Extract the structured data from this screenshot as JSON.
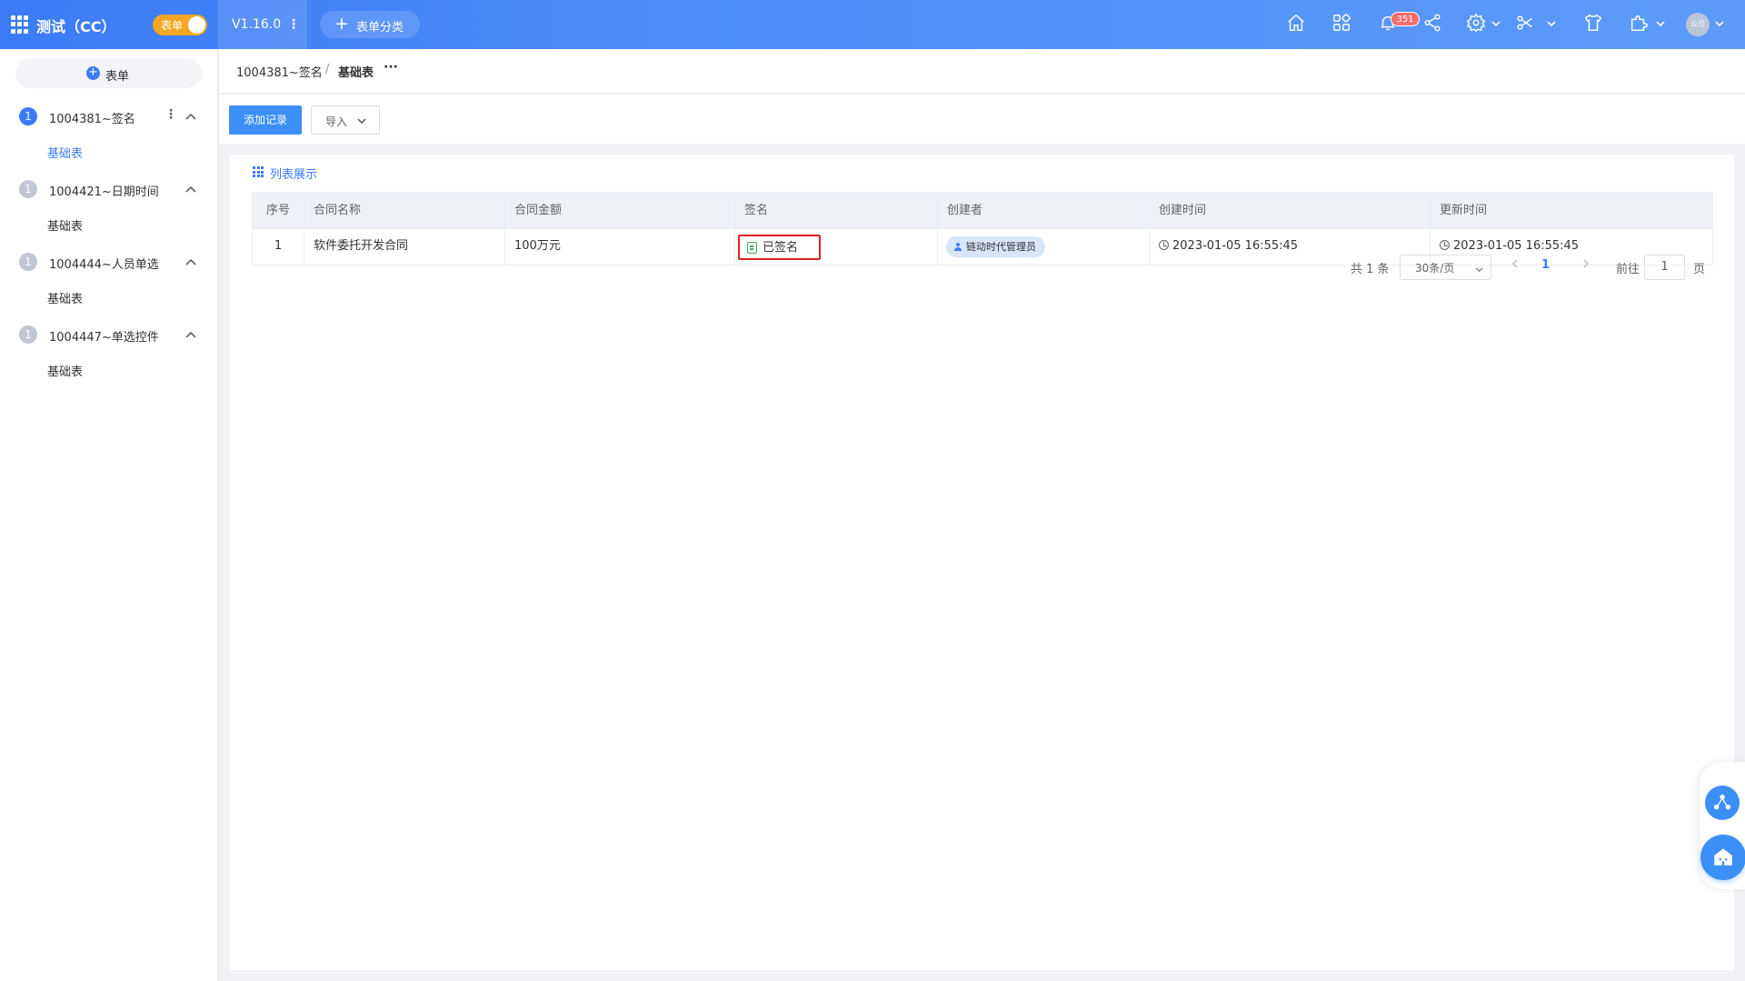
{
  "topbar": {
    "app_title": "测试（CC）",
    "toggle_label": "表单",
    "version": "V1.16.0",
    "add_category": "表单分类",
    "notification_count": "351",
    "avatar_text": "公司",
    "icons": [
      "home-icon",
      "apps-icon",
      "bell-icon",
      "share-icon",
      "gear-icon",
      "tools-icon",
      "shirt-icon",
      "plugin-icon",
      "avatar"
    ]
  },
  "sidebar": {
    "new_form_label": "表单",
    "groups": [
      {
        "num": "1",
        "title": "1004381~签名",
        "sub": "基础表",
        "active": true
      },
      {
        "num": "1",
        "title": "1004421~日期时间",
        "sub": "基础表",
        "active": false
      },
      {
        "num": "1",
        "title": "1004444~人员单选",
        "sub": "基础表",
        "active": false
      },
      {
        "num": "1",
        "title": "1004447~单选控件",
        "sub": "基础表",
        "active": false
      }
    ]
  },
  "breadcrumb": {
    "item1": "1004381~签名",
    "separator": "/",
    "item2": "基础表",
    "more": "···"
  },
  "actions": {
    "add_record": "添加记录",
    "import": "导入"
  },
  "view": {
    "label": "列表展示"
  },
  "table": {
    "columns": [
      "序号",
      "合同名称",
      "合同金额",
      "签名",
      "创建者",
      "创建时间",
      "更新时间"
    ],
    "rows": [
      {
        "index": "1",
        "contract_name": "软件委托开发合同",
        "amount": "100万元",
        "signature": "已签名",
        "creator": "链动时代管理员",
        "created_at": "2023-01-05 16:55:45",
        "updated_at": "2023-01-05 16:55:45"
      }
    ]
  },
  "pagination": {
    "total": "共 1 条",
    "page_size": "30条/页",
    "current_page": "1",
    "goto_label": "前往",
    "goto_value": "1",
    "page_suffix": "页"
  },
  "colors": {
    "primary": "#3b7bf6",
    "toggle": "#f5a623",
    "badge": "#f56c6c",
    "signature_highlight": "#e02020",
    "signature_icon": "#3aa85c"
  }
}
